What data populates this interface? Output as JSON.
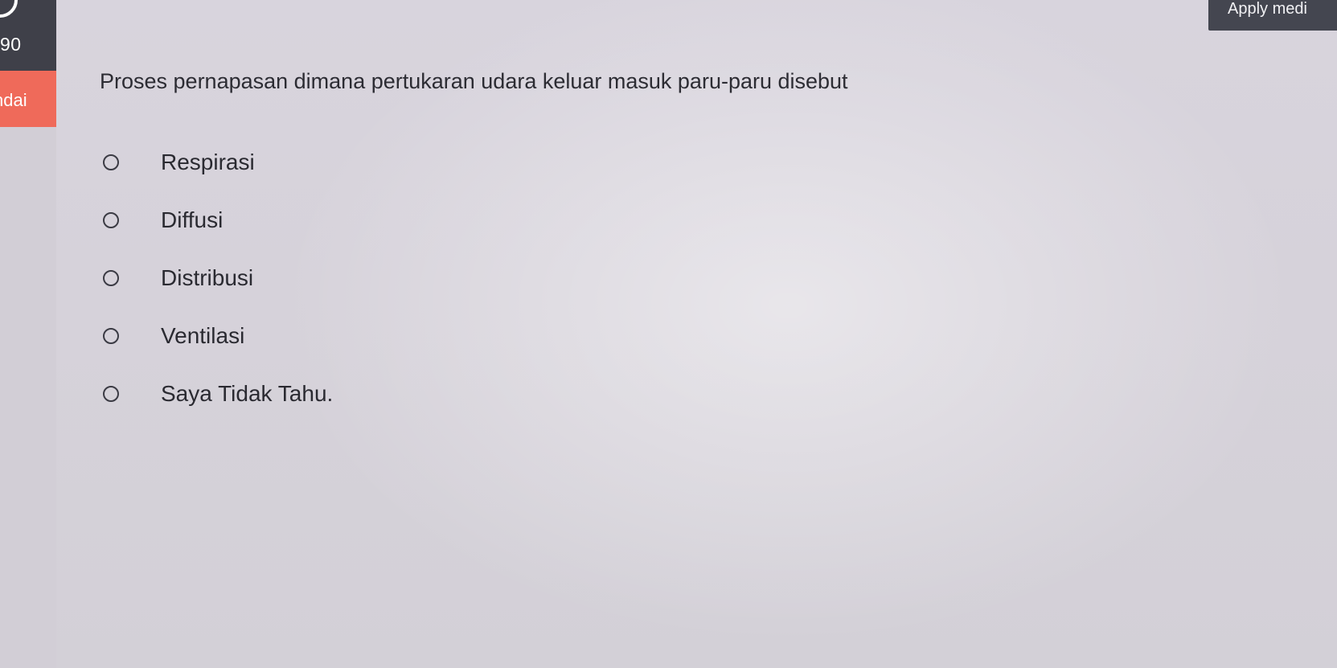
{
  "sidebar": {
    "counter_number": "90",
    "tab_label": "ndai"
  },
  "header": {
    "apply_button_label": "Apply medi"
  },
  "quiz": {
    "question": "Proses pernapasan dimana pertukaran udara keluar masuk paru-paru disebut",
    "options": [
      {
        "label": "Respirasi"
      },
      {
        "label": "Diffusi"
      },
      {
        "label": "Distribusi"
      },
      {
        "label": "Ventilasi"
      },
      {
        "label": "Saya Tidak Tahu."
      }
    ]
  },
  "colors": {
    "sidebar_dark": "#3f4049",
    "tab_accent": "#ef6a5a",
    "page_background": "#d9d5de",
    "text": "#2c2c33"
  }
}
